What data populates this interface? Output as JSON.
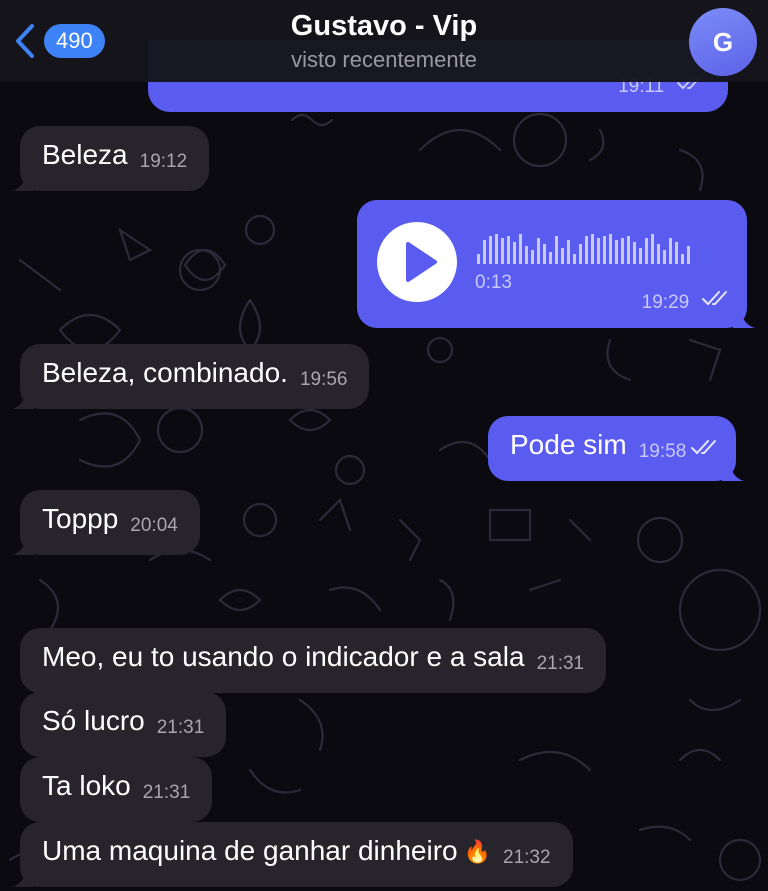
{
  "header": {
    "unread_count": "490",
    "title": "Gustavo - Vip",
    "status": "visto recentemente",
    "avatar_initial": "G"
  },
  "colors": {
    "background": "#0b0a10",
    "incoming_bubble": "#27242b",
    "outgoing_bubble": "#5a5cf0",
    "accent": "#3e82f7",
    "avatar": "#6c72ef"
  },
  "messages": [
    {
      "direction": "out",
      "text": "",
      "time": "19:11",
      "status": "read"
    },
    {
      "direction": "in",
      "text": "Beleza",
      "time": "19:12"
    },
    {
      "direction": "out",
      "type": "voice",
      "duration": "0:13",
      "time": "19:29",
      "status": "read"
    },
    {
      "direction": "in",
      "text": "Beleza, combinado.",
      "time": "19:56"
    },
    {
      "direction": "out",
      "text": "Pode sim",
      "time": "19:58",
      "status": "read"
    },
    {
      "direction": "in",
      "text": "Toppp",
      "time": "20:04"
    },
    {
      "direction": "in",
      "text": "Meo, eu to usando o indicador e a sala",
      "time": "21:31"
    },
    {
      "direction": "in",
      "text": "Só lucro",
      "time": "21:31"
    },
    {
      "direction": "in",
      "text": "Ta loko",
      "time": "21:31"
    },
    {
      "direction": "in",
      "text": "Uma maquina de ganhar dinheiro",
      "emoji": "🔥",
      "emoji_icon": "fire-icon",
      "time": "21:32"
    }
  ]
}
